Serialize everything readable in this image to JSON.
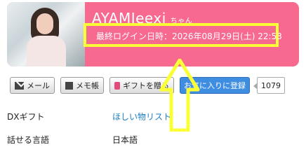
{
  "profile": {
    "name": "AYAMIeexi",
    "name_suffix": "ちゃん",
    "last_login": "最終ログイン日時：2026年08月29日(土) 22:53"
  },
  "buttons": {
    "mail": "メール",
    "memo": "メモ帳",
    "gift": "ギフトを贈る",
    "favorite": "お気に入りに登録",
    "favorite_count": "1079"
  },
  "details": {
    "dx_gift_label": "DXギフト",
    "dx_gift_link": "ほしい物リスト",
    "language_label": "話せる言語",
    "language_value": "日本語"
  },
  "colors": {
    "header_bg": "#f7698f",
    "highlight_box": "#fbff35",
    "favorite_button": "#3f8de1",
    "link": "#1a7dc4",
    "arrow": "#fbff35"
  },
  "icons": [
    "mail-icon",
    "memo-icon",
    "gift-icon",
    "up-arrow-annotation"
  ]
}
